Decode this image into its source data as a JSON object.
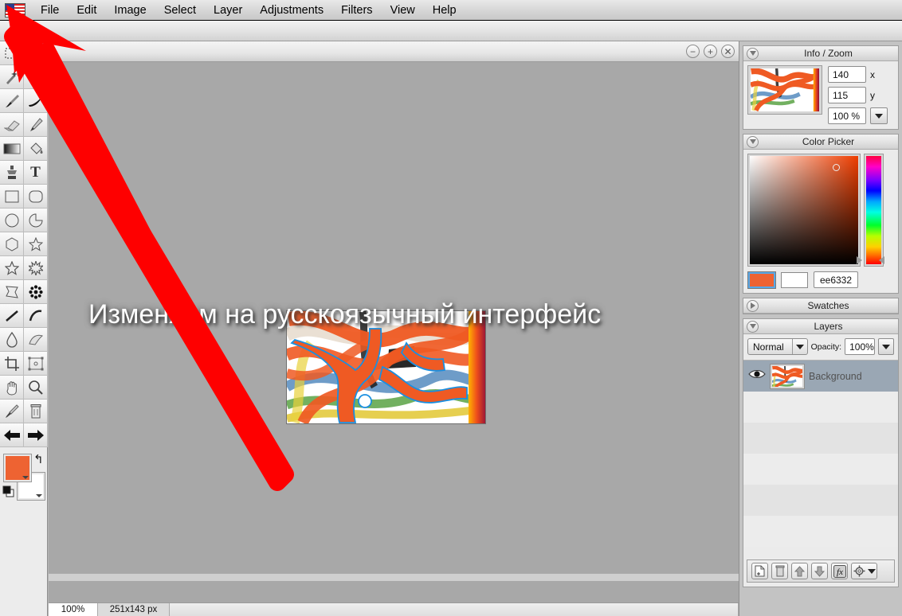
{
  "menubar": {
    "flag_icon": "us-flag-icon",
    "items": [
      {
        "label": "File"
      },
      {
        "label": "Edit"
      },
      {
        "label": "Image"
      },
      {
        "label": "Select"
      },
      {
        "label": "Layer"
      },
      {
        "label": "Adjustments"
      },
      {
        "label": "Filters"
      },
      {
        "label": "View"
      },
      {
        "label": "Help"
      }
    ]
  },
  "toolbox": {
    "tools": [
      {
        "name": "rectangle-select-tool",
        "icon": "dashed-rectangle-icon",
        "selected": false
      },
      {
        "name": "move-tool",
        "icon": "cursor-arrow-icon",
        "selected": true
      },
      {
        "name": "magic-wand-tool",
        "icon": "magic-wand-icon",
        "selected": false
      },
      {
        "name": "lasso-select-tool",
        "icon": "lasso-icon",
        "selected": false
      },
      {
        "name": "paintbrush-tool",
        "icon": "paintbrush-icon",
        "selected": false
      },
      {
        "name": "ink-brush-tool",
        "icon": "ink-stroke-icon",
        "selected": false
      },
      {
        "name": "eraser-tool",
        "icon": "eraser-icon",
        "selected": false
      },
      {
        "name": "pencil-tool",
        "icon": "pencil-icon",
        "selected": false
      },
      {
        "name": "gradient-tool",
        "icon": "gradient-icon",
        "selected": false
      },
      {
        "name": "paint-bucket-tool",
        "icon": "paint-bucket-icon",
        "selected": false
      },
      {
        "name": "clone-stamp-tool",
        "icon": "clone-stamp-icon",
        "selected": false
      },
      {
        "name": "text-tool",
        "icon": "text-t-icon",
        "selected": false
      },
      {
        "name": "rectangle-shape-tool",
        "icon": "square-icon",
        "selected": false
      },
      {
        "name": "rounded-rectangle-tool",
        "icon": "rounded-square-icon",
        "selected": false
      },
      {
        "name": "ellipse-shape-tool",
        "icon": "circle-icon",
        "selected": false
      },
      {
        "name": "pie-shape-tool",
        "icon": "pie-icon",
        "selected": false
      },
      {
        "name": "polygon-shape-tool",
        "icon": "hexagon-icon",
        "selected": false
      },
      {
        "name": "star-shape-tool",
        "icon": "star-icon",
        "selected": false
      },
      {
        "name": "star-outline-tool",
        "icon": "star-outline-icon",
        "selected": false
      },
      {
        "name": "burst-shape-tool",
        "icon": "burst-icon",
        "selected": false
      },
      {
        "name": "banner-shape-tool",
        "icon": "banner-icon",
        "selected": false
      },
      {
        "name": "flower-shape-tool",
        "icon": "flower-icon",
        "selected": false
      },
      {
        "name": "line-tool",
        "icon": "line-icon",
        "selected": false
      },
      {
        "name": "curve-tool",
        "icon": "curve-icon",
        "selected": false
      },
      {
        "name": "blur-tool",
        "icon": "water-drop-icon",
        "selected": false
      },
      {
        "name": "smudge-tool",
        "icon": "smudge-finger-icon",
        "selected": false
      },
      {
        "name": "crop-tool",
        "icon": "crop-icon",
        "selected": false
      },
      {
        "name": "transform-tool",
        "icon": "transform-box-icon",
        "selected": false
      },
      {
        "name": "hand-tool",
        "icon": "hand-icon",
        "selected": false
      },
      {
        "name": "zoom-tool",
        "icon": "magnifier-icon",
        "selected": false
      },
      {
        "name": "eyedropper-tool",
        "icon": "eyedropper-icon",
        "selected": false
      },
      {
        "name": "delete-tool",
        "icon": "trash-icon",
        "selected": false
      },
      {
        "name": "undo-arrow-tool",
        "icon": "arrow-left-icon",
        "selected": false
      },
      {
        "name": "redo-arrow-tool",
        "icon": "arrow-right-icon",
        "selected": false
      }
    ],
    "foreground_color": "#ee6332",
    "background_color": "#ffffff",
    "reset_icon": "reset-arrow-icon",
    "swap_icon": "swap-colors-icon"
  },
  "canvas": {
    "titlebar_buttons": [
      {
        "name": "zoom-out-button",
        "glyph": "−"
      },
      {
        "name": "zoom-in-button",
        "glyph": "+"
      },
      {
        "name": "close-button",
        "glyph": "✕"
      }
    ],
    "overlay_text": "Изменяем на русскоязычный интерфейс",
    "status": {
      "zoom": "100%",
      "dimensions": "251x143 px"
    }
  },
  "panels": {
    "info_zoom": {
      "title": "Info / Zoom",
      "expanded": true,
      "x_value": "140",
      "x_label": "x",
      "y_value": "115",
      "y_label": "y",
      "zoom_value": "100 %"
    },
    "color_picker": {
      "title": "Color Picker",
      "expanded": true,
      "hex_value": "ee6332",
      "primary_color": "#ee6332",
      "secondary_color": "#ffffff"
    },
    "swatches": {
      "title": "Swatches",
      "expanded": false
    },
    "layers": {
      "title": "Layers",
      "expanded": true,
      "blend_mode": "Normal",
      "opacity_label": "Opacity:",
      "opacity_value": "100%",
      "rows": [
        {
          "name": "Background",
          "visible": true,
          "selected": true
        }
      ],
      "toolbar": [
        {
          "name": "add-layer-button",
          "icon": "new-page-icon"
        },
        {
          "name": "delete-layer-button",
          "icon": "trash-icon"
        },
        {
          "name": "move-layer-up-button",
          "icon": "arrow-up-icon"
        },
        {
          "name": "move-layer-down-button",
          "icon": "arrow-down-icon"
        },
        {
          "name": "layer-effects-button",
          "icon": "fx-icon"
        },
        {
          "name": "layer-properties-button",
          "icon": "gear-icon"
        }
      ]
    }
  },
  "annotation": {
    "arrow_color": "#fe0000",
    "arrow_target": "us-flag-language-button"
  }
}
